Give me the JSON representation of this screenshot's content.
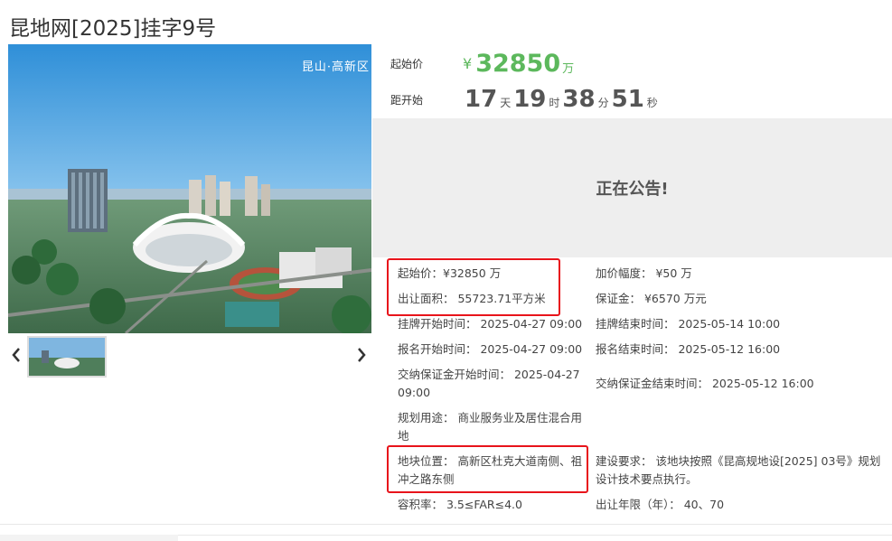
{
  "page": {
    "title": "昆地网[2025]挂字9号"
  },
  "gallery": {
    "watermark": "昆山·高新区",
    "prev_icon": "chevron-left-icon",
    "next_icon": "chevron-right-icon"
  },
  "summary": {
    "start_price_label": "起始价",
    "currency_symbol": "¥",
    "start_price_value": "32850",
    "start_price_unit": "万",
    "countdown_label": "距开始",
    "days": "17",
    "days_unit": "天",
    "hours": "19",
    "hours_unit": "时",
    "minutes": "38",
    "minutes_unit": "分",
    "seconds": "51",
    "seconds_unit": "秒",
    "status": "正在公告!"
  },
  "details": {
    "start_price": "起始价：¥32850 万",
    "increment": "加价幅度：  ¥50 万",
    "area": "出让面积：  55723.71平方米",
    "deposit": "保证金：  ¥6570 万元",
    "listing_start": "挂牌开始时间：  2025-04-27 09:00",
    "listing_end": "挂牌结束时间：  2025-05-14 10:00",
    "signup_start": "报名开始时间：  2025-04-27 09:00",
    "signup_end": "报名结束时间：  2025-05-12 16:00",
    "deposit_start_line1": "交纳保证金开始时间：  2025-04-27",
    "deposit_start_line2": "09:00",
    "deposit_end": "交纳保证金结束时间：  2025-05-12 16:00",
    "usage_line1": "规划用途：  商业服务业及居住混合用",
    "usage_line2": "地",
    "location_line1": "地块位置：  高新区杜克大道南侧、祖",
    "location_line2": "冲之路东侧",
    "requirement_line1": "建设要求：  该地块按照《昆高规地设[2025] 03号》规划",
    "requirement_line2": "设计技术要点执行。",
    "far": "容积率：  3.5≤FAR≤4.0",
    "term": "出让年限（年）：  40、70"
  },
  "colors": {
    "price_green": "#5cb85c",
    "highlight_red": "#e8141b",
    "notice_bg": "#eeeeee"
  }
}
